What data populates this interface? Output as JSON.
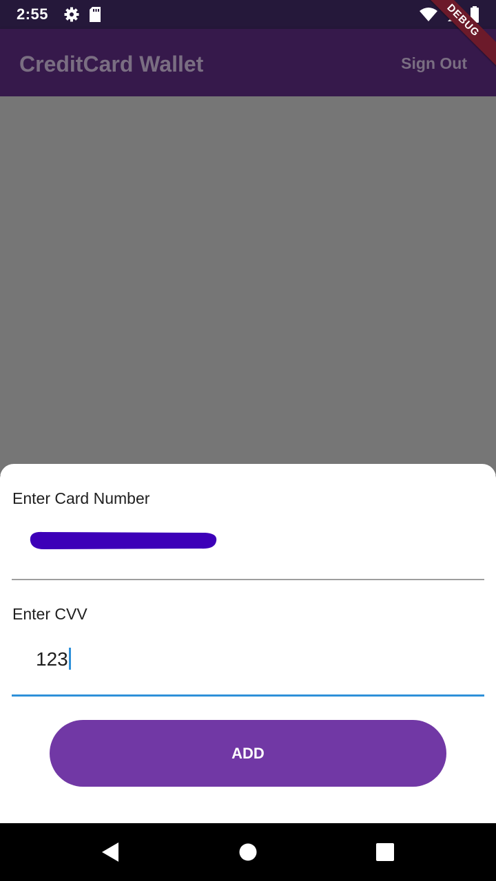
{
  "status_bar": {
    "time": "2:55",
    "left_icons": [
      "gear-icon",
      "sd-card-icon"
    ],
    "right_icons": [
      "wifi-icon",
      "battery-icon"
    ]
  },
  "debug_banner": "DEBUG",
  "app_bar": {
    "title": "CreditCard Wallet",
    "sign_out_label": "Sign Out"
  },
  "bottom_sheet": {
    "card_number_label": "Enter Card Number",
    "card_number_value_state": "redacted",
    "cvv_label": "Enter CVV",
    "cvv_value": "123",
    "add_button_label": "ADD"
  },
  "nav_bar": {
    "buttons": [
      "back-icon",
      "home-icon",
      "recents-icon"
    ]
  },
  "colors": {
    "status_bar": "#25183a",
    "app_bar": "#36194b",
    "scrim": "#767676",
    "redaction": "#3d00b8",
    "focus_underline": "#2e90d9",
    "add_button": "#7138a5"
  }
}
